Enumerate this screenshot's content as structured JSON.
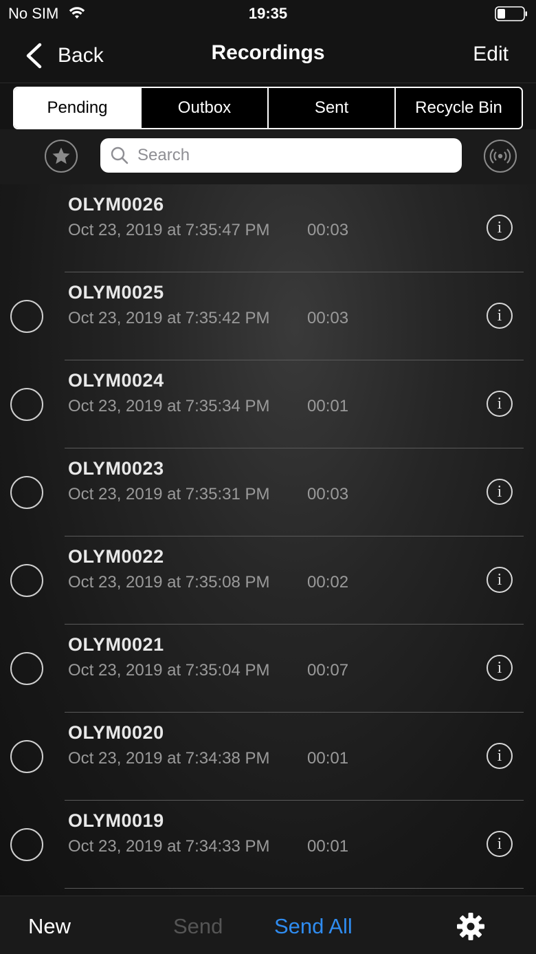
{
  "status": {
    "carrier": "No SIM",
    "time": "19:35"
  },
  "nav": {
    "back_label": "Back",
    "title": "Recordings",
    "edit_label": "Edit"
  },
  "tabs": [
    {
      "label": "Pending",
      "active": true
    },
    {
      "label": "Outbox",
      "active": false
    },
    {
      "label": "Sent",
      "active": false
    },
    {
      "label": "Recycle Bin",
      "active": false
    }
  ],
  "search": {
    "placeholder": "Search"
  },
  "recordings": [
    {
      "name": "OLYM0026",
      "date": "Oct 23, 2019 at 7:35:47 PM",
      "duration": "00:03",
      "show_select": false
    },
    {
      "name": "OLYM0025",
      "date": "Oct 23, 2019 at 7:35:42 PM",
      "duration": "00:03",
      "show_select": true
    },
    {
      "name": "OLYM0024",
      "date": "Oct 23, 2019 at 7:35:34 PM",
      "duration": "00:01",
      "show_select": true
    },
    {
      "name": "OLYM0023",
      "date": "Oct 23, 2019 at 7:35:31 PM",
      "duration": "00:03",
      "show_select": true
    },
    {
      "name": "OLYM0022",
      "date": "Oct 23, 2019 at 7:35:08 PM",
      "duration": "00:02",
      "show_select": true
    },
    {
      "name": "OLYM0021",
      "date": "Oct 23, 2019 at 7:35:04 PM",
      "duration": "00:07",
      "show_select": true
    },
    {
      "name": "OLYM0020",
      "date": "Oct 23, 2019 at 7:34:38 PM",
      "duration": "00:01",
      "show_select": true
    },
    {
      "name": "OLYM0019",
      "date": "Oct 23, 2019 at 7:34:33 PM",
      "duration": "00:01",
      "show_select": true
    }
  ],
  "toolbar": {
    "new_label": "New",
    "send_label": "Send",
    "send_all_label": "Send All"
  },
  "colors": {
    "accent": "#2f8cf0",
    "disabled": "#555555",
    "background": "#141414"
  }
}
